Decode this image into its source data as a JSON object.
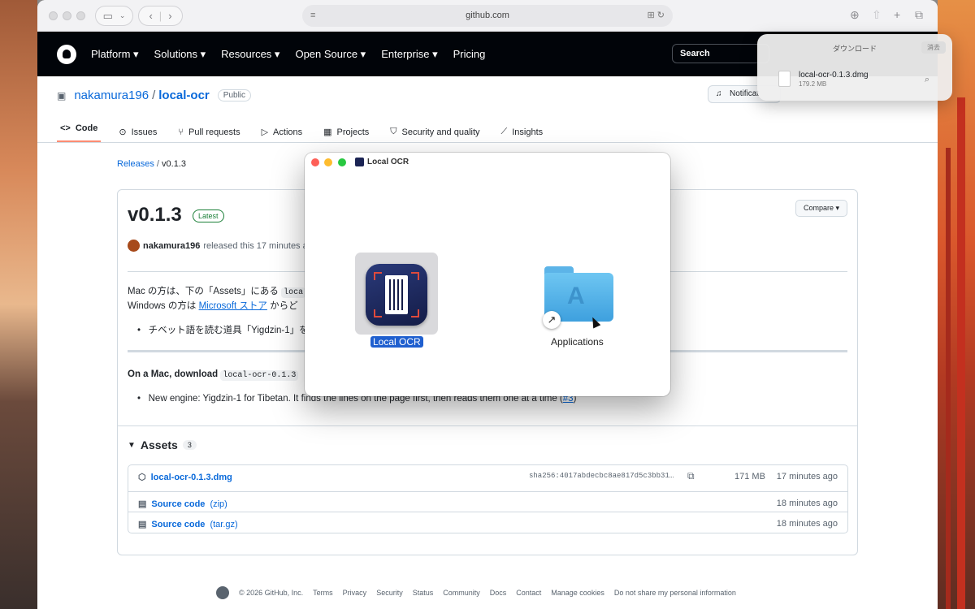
{
  "browser": {
    "url": "github.com"
  },
  "github": {
    "nav": [
      "Platform ▾",
      "Solutions ▾",
      "Resources ▾",
      "Open Source ▾",
      "Enterprise ▾",
      "Pricing"
    ],
    "search_label": "Search",
    "repo_owner": "nakamura196",
    "repo_name": "local-ocr",
    "repo_visibility": "Public",
    "notifications_label": "Notificat",
    "tabs": [
      "Code",
      "Issues",
      "Pull requests",
      "Actions",
      "Projects",
      "Security and quality",
      "Insights"
    ],
    "active_tab": "Code"
  },
  "breadcrumb": {
    "releases": "Releases",
    "current": "v0.1.3"
  },
  "release": {
    "version": "v0.1.3",
    "badge": "Latest",
    "compare_label": "Compare ▾",
    "author": "nakamura196",
    "released_text": "released this 17 minutes ag",
    "body_line1_a": "Mac の方は、下の「Assets」にある",
    "body_line1_code": "loca",
    "body_line2_a": "Windows の方は",
    "body_line2_link": "Microsoft ストア",
    "body_line2_b": "からど",
    "bullet1": "チベット語を読む道具「Yigdzin-1」を",
    "mac_line": "On a Mac, download",
    "mac_code": "local-ocr-0.1.3",
    "bullet2_a": "New engine: Yigdzin-1 for Tibetan. It finds the lines on the page first, then reads them one at a time (",
    "bullet2_link": "#3",
    "bullet2_b": ")"
  },
  "assets": {
    "title": "Assets",
    "count": "3",
    "rows": [
      {
        "name": "local-ocr-0.1.3.dmg",
        "suffix": "",
        "hash": "sha256:4017abdecbc8ae817d5c3bb31…",
        "size": "171 MB",
        "time": "17 minutes ago"
      },
      {
        "name": "Source code",
        "suffix": "(zip)",
        "hash": "",
        "size": "",
        "time": "18 minutes ago"
      },
      {
        "name": "Source code",
        "suffix": "(tar.gz)",
        "hash": "",
        "size": "",
        "time": "18 minutes ago"
      }
    ]
  },
  "footer": [
    "© 2026 GitHub, Inc.",
    "Terms",
    "Privacy",
    "Security",
    "Status",
    "Community",
    "Docs",
    "Contact",
    "Manage cookies",
    "Do not share my personal information"
  ],
  "downloads": {
    "title": "ダウンロード",
    "clear": "消去",
    "file_name": "local-ocr-0.1.3.dmg",
    "file_size": "179.2 MB"
  },
  "finder": {
    "title": "Local OCR",
    "app_label": "Local OCR",
    "folder_label": "Applications",
    "colors": {
      "close": "#fe5f57",
      "minimize": "#febc2e",
      "zoom": "#28c840"
    }
  },
  "colors": {
    "link": "#0969da",
    "gh_header": "#010409",
    "latest": "#1a7f37",
    "selection": "#1f5fcf"
  }
}
